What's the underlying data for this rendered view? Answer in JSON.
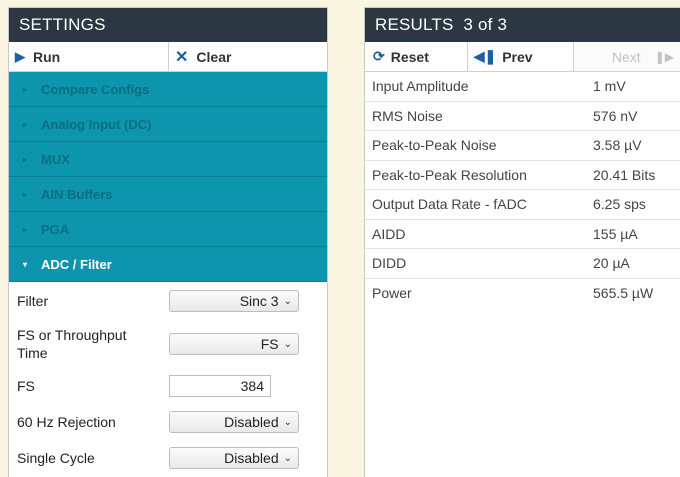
{
  "settings": {
    "title": "SETTINGS",
    "run_label": "Run",
    "clear_label": "Clear",
    "sections": [
      {
        "label": "Compare Configs",
        "open": false
      },
      {
        "label": "Analog Input (DC)",
        "open": false
      },
      {
        "label": "MUX",
        "open": false
      },
      {
        "label": "AIN Buffers",
        "open": false
      },
      {
        "label": "PGA",
        "open": false
      },
      {
        "label": "ADC / Filter",
        "open": true
      }
    ],
    "fields": {
      "filter": {
        "label": "Filter",
        "value": "Sinc 3"
      },
      "fs_or_throughput": {
        "label": "FS or Throughput Time",
        "value": "FS"
      },
      "fs": {
        "label": "FS",
        "value": "384"
      },
      "rejection_60hz": {
        "label": "60 Hz Rejection",
        "value": "Disabled"
      },
      "single_cycle": {
        "label": "Single Cycle",
        "value": "Disabled"
      }
    }
  },
  "results": {
    "title": "RESULTS  3 of 3",
    "reset_label": "Reset",
    "prev_label": "Prev",
    "next_label": "Next",
    "rows": [
      {
        "name": "Input Amplitude",
        "value": "1 mV"
      },
      {
        "name": "RMS Noise",
        "value": "576 nV"
      },
      {
        "name": "Peak-to-Peak Noise",
        "value": "3.58 µV"
      },
      {
        "name": "Peak-to-Peak Resolution",
        "value": "20.41 Bits"
      },
      {
        "name": "Output Data Rate - fADC",
        "value": "6.25 sps"
      },
      {
        "name": "AIDD",
        "value": "155 µA"
      },
      {
        "name": "DIDD",
        "value": "20 µA"
      },
      {
        "name": "Power",
        "value": "565.5 µW"
      }
    ]
  },
  "colors": {
    "header_bg": "#2c3744",
    "accordion_bg": "#0e95ae",
    "accent_icon": "#1f5fa0",
    "page_bg": "#fbf6e2"
  }
}
